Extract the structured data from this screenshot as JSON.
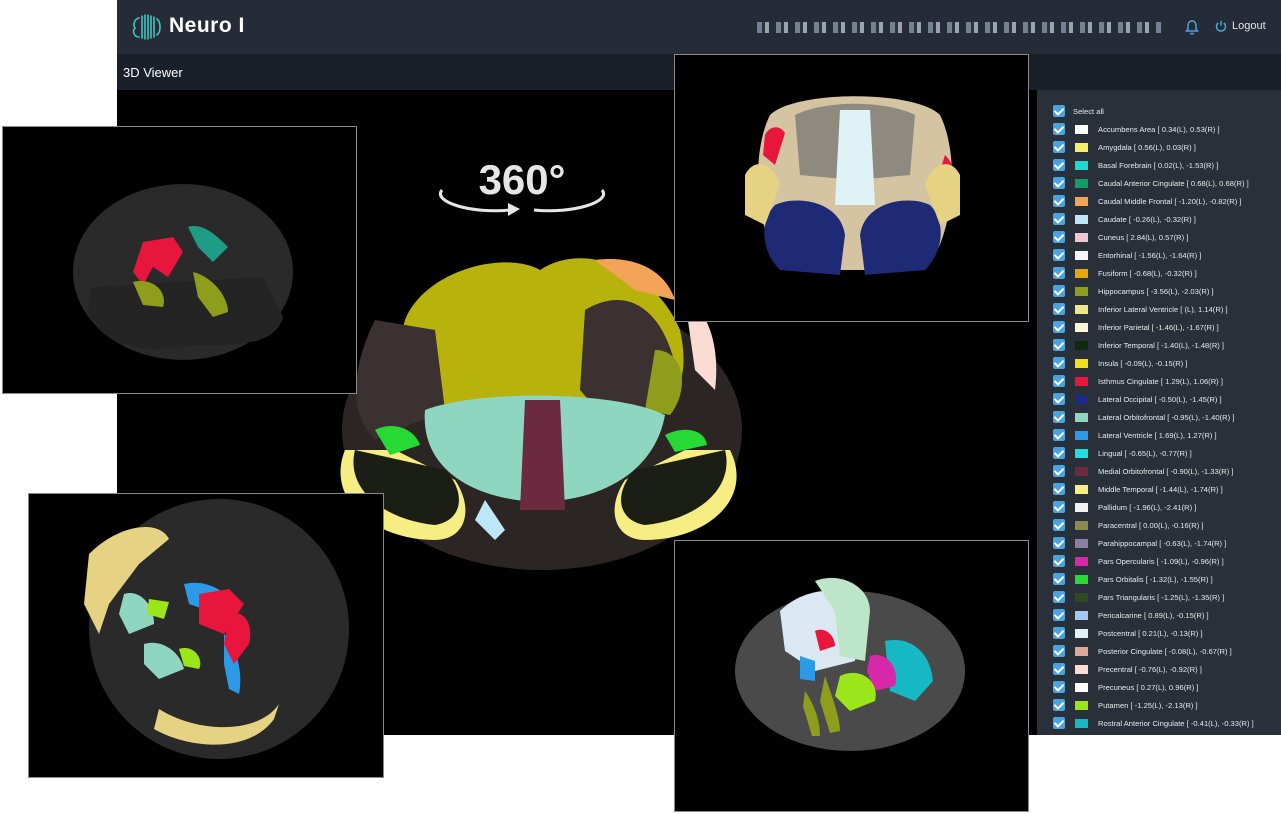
{
  "header": {
    "brand": "Neuro I",
    "logout_label": "Logout"
  },
  "subheader": {
    "title": "3D Viewer"
  },
  "viewer": {
    "rotation_badge": "360°"
  },
  "legend": {
    "select_all_label": "Select all",
    "items": [
      {
        "label": "Accumbens Area [ 0.34(L), 0.53(R) ]",
        "color": "#ffffff"
      },
      {
        "label": "Amygdala [ 0.56(L), 0.03(R) ]",
        "color": "#f4ef6a"
      },
      {
        "label": "Basal Forebrain [ 0.02(L), -1.53(R) ]",
        "color": "#22d6d0"
      },
      {
        "label": "Caudal Anterior Cingulate [ 0.68(L), 0.68(R) ]",
        "color": "#149c66"
      },
      {
        "label": "Caudal Middle Frontal [ -1.20(L), -0.82(R) ]",
        "color": "#f4a458"
      },
      {
        "label": "Caudate [ -0.26(L), -0.32(R) ]",
        "color": "#bde6f6"
      },
      {
        "label": "Cuneus [ 2.84(L), 0.57(R) ]",
        "color": "#f1c7cf"
      },
      {
        "label": "Entorhinal [ -1.56(L), -1.64(R) ]",
        "color": "#f7f7f7"
      },
      {
        "label": "Fusiform [ -0.68(L), -0.32(R) ]",
        "color": "#e8a60e"
      },
      {
        "label": "Hippocampus [ -3.56(L), -2.03(R) ]",
        "color": "#8e9e1c"
      },
      {
        "label": "Inferior Lateral Ventricle [ (L), 1.14(R) ]",
        "color": "#efe58c"
      },
      {
        "label": "Inferior Parietal [ -1.46(L), -1.67(R) ]",
        "color": "#fbf6d8"
      },
      {
        "label": "Inferior Temporal [ -1.40(L), -1.48(R) ]",
        "color": "#0f2a10"
      },
      {
        "label": "Insula [ -0.09(L), -0.15(R) ]",
        "color": "#f2e01f"
      },
      {
        "label": "Isthmus Cingulate [ 1.29(L), 1.06(R) ]",
        "color": "#e8163c"
      },
      {
        "label": "Lateral Occipital [ -0.50(L), -1.45(R) ]",
        "color": "#1f2a86"
      },
      {
        "label": "Lateral Orbitofrontal [ -0.95(L), -1.40(R) ]",
        "color": "#8ed6bf"
      },
      {
        "label": "Lateral Ventricle [ 1.69(L), 1.27(R) ]",
        "color": "#2c9ae6"
      },
      {
        "label": "Lingual [ -0.65(L), -0.77(R) ]",
        "color": "#22dede"
      },
      {
        "label": "Medial Orbitofrontal [ -0.90(L), -1.33(R) ]",
        "color": "#6b2a40"
      },
      {
        "label": "Middle Temporal [ -1.44(L), -1.74(R) ]",
        "color": "#f6ee82"
      },
      {
        "label": "Pallidum [ -1.96(L), -2.41(R) ]",
        "color": "#f2f2f2"
      },
      {
        "label": "Paracentral [ 0.00(L), -0.16(R) ]",
        "color": "#8c8a4c"
      },
      {
        "label": "Parahippocampal [ -0.63(L), -1.74(R) ]",
        "color": "#8a7fa2"
      },
      {
        "label": "Pars Opercularis [ -1.09(L), -0.96(R) ]",
        "color": "#d628a8"
      },
      {
        "label": "Pars Orbitalis [ -1.32(L), -1.55(R) ]",
        "color": "#27d934"
      },
      {
        "label": "Pars Triangularis [ -1.25(L), -1.35(R) ]",
        "color": "#2f4a1f"
      },
      {
        "label": "Pericalcarine [ 0.89(L), -0.15(R) ]",
        "color": "#a3c8f2"
      },
      {
        "label": "Postcentral [ 0.21(L), -0.13(R) ]",
        "color": "#dff3f6"
      },
      {
        "label": "Posterior Cingulate [ -0.08(L), -0.67(R) ]",
        "color": "#dba89a"
      },
      {
        "label": "Precentral [ -0.76(L), -0.92(R) ]",
        "color": "#fbdcd2"
      },
      {
        "label": "Precuneus [ 0.27(L), 0.96(R) ]",
        "color": "#ffffff"
      },
      {
        "label": "Putamen [ -1.25(L), -2.13(R) ]",
        "color": "#9be61a"
      },
      {
        "label": "Rostral Anterior Cingulate [ -0.41(L), -0.33(R) ]",
        "color": "#16b8c4"
      }
    ]
  }
}
